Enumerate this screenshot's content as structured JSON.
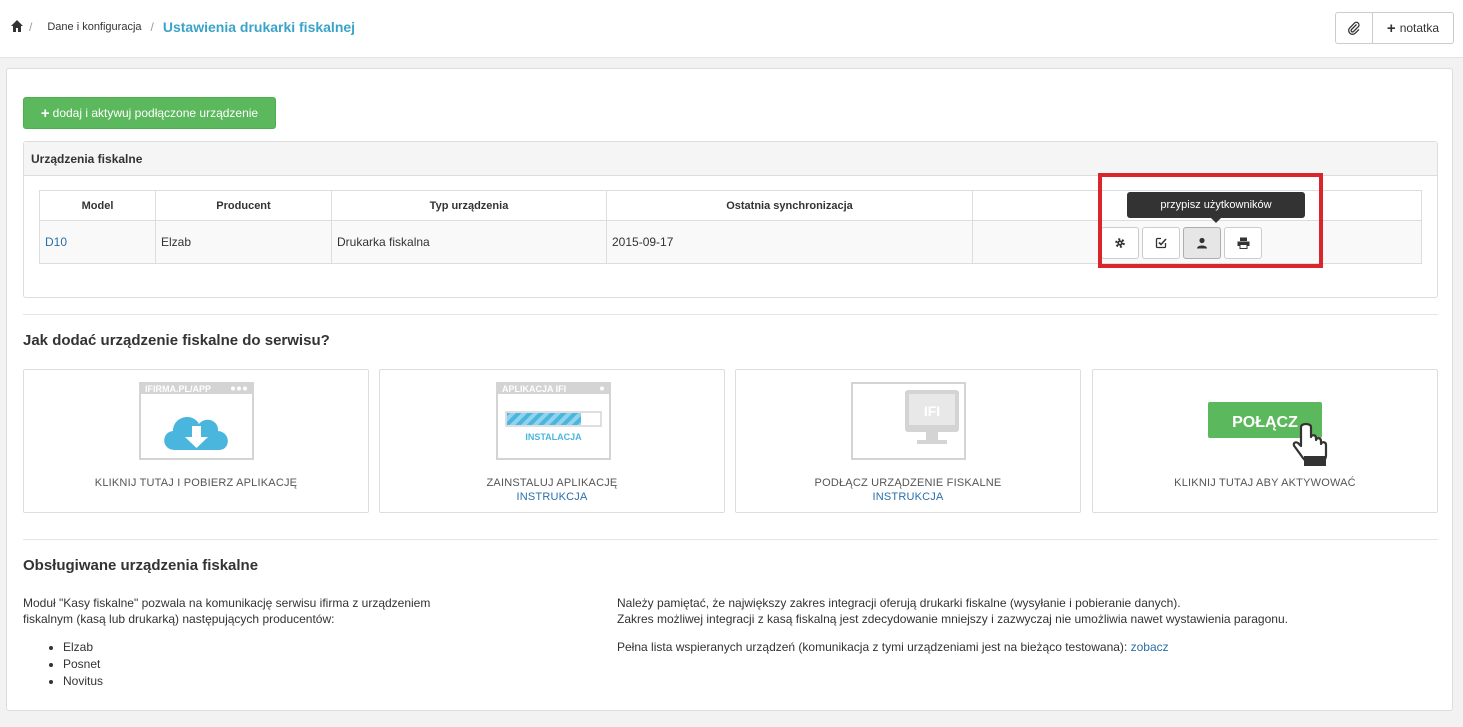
{
  "breadcrumb": {
    "home_icon": "home-icon",
    "item1": "Dane i konfiguracja",
    "current": "Ustawienia drukarki fiskalnej"
  },
  "toolbar": {
    "attach_icon": "paperclip-icon",
    "note_label": "notatka"
  },
  "add_button_label": "dodaj i aktywuj podłączone urządzenie",
  "panel": {
    "title": "Urządzenia fiskalne",
    "columns": [
      "Model",
      "Producent",
      "Typ urządzenia",
      "Ostatnia synchronizacja",
      ""
    ],
    "row": {
      "model": "D10",
      "producer": "Elzab",
      "type": "Drukarka fiskalna",
      "last_sync": "2015-09-17"
    },
    "actions": [
      "gear-icon",
      "edit-check-icon",
      "user-icon",
      "print-icon"
    ],
    "tooltip": "przypisz użytkowników"
  },
  "how_title": "Jak dodać urządzenie fiskalne do serwisu?",
  "steps": [
    {
      "graphic_label": "IFIRMA.PL/APP",
      "caption": "KLIKNIJ TUTAJ I POBIERZ APLIKACJĘ",
      "link": ""
    },
    {
      "graphic_label": "APLIKACJA IFI",
      "graphic_sub": "INSTALACJA",
      "caption": "ZAINSTALUJ APLIKACJĘ",
      "link": "INSTRUKCJA"
    },
    {
      "graphic_label": "IFI",
      "caption": "PODŁĄCZ URZĄDZENIE FISKALNE",
      "link": "INSTRUKCJA"
    },
    {
      "graphic_label": "POŁĄCZ",
      "caption": "KLIKNIJ TUTAJ ABY AKTYWOWAĆ",
      "link": ""
    }
  ],
  "supported": {
    "title": "Obsługiwane urządzenia fiskalne",
    "left_text": "Moduł \"Kasy fiskalne\" pozwala na komunikację serwisu ifirma z urządzeniem fiskalnym (kasą lub drukarką) następujących producentów:",
    "brands": [
      "Elzab",
      "Posnet",
      "Novitus"
    ],
    "right_line1": "Należy pamiętać, że największy zakres integracji oferują drukarki fiskalne (wysyłanie i pobieranie danych).",
    "right_line2": "Zakres możliwej integracji z kasą fiskalną jest zdecydowanie mniejszy i zazwyczaj nie umożliwia nawet wystawienia paragonu.",
    "right_line3": "Pełna lista wspieranych urządzeń (komunikacja z tymi urządzeniami jest na bieżąco testowana):",
    "right_link": "zobacz"
  },
  "colors": {
    "accent": "#3aa3c9",
    "success": "#5cb85c",
    "link": "#2a6fa8",
    "highlight": "#d9262c"
  }
}
